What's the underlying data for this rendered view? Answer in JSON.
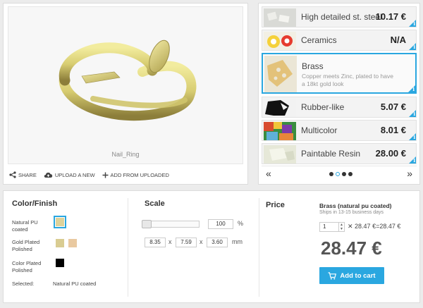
{
  "viewer": {
    "model_name": "Nail_Ring",
    "actions": [
      {
        "icon": "share-icon",
        "label": "SHARE"
      },
      {
        "icon": "cloud-upload-icon",
        "label": "UPLOAD A NEW"
      },
      {
        "icon": "plus-icon",
        "label": "ADD FROM UPLOADED"
      }
    ]
  },
  "materials": [
    {
      "name": "High detailed st. steel",
      "price": "10.17 €",
      "thumb": "steel-thumbnail"
    },
    {
      "name": "Ceramics",
      "price": "N/A",
      "thumb": "ceramics-thumbnail"
    },
    {
      "name": "Brass",
      "price": "",
      "description": "Copper meets Zinc, plated to have a 18kt gold look",
      "selected": true,
      "thumb": "brass-thumbnail"
    },
    {
      "name": "Rubber-like",
      "price": "5.07 €",
      "thumb": "rubber-thumbnail"
    },
    {
      "name": "Multicolor",
      "price": "8.01 €",
      "thumb": "multicolor-thumbnail"
    },
    {
      "name": "Paintable Resin",
      "price": "28.00 €",
      "thumb": "resin-thumbnail"
    }
  ],
  "carousel": {
    "prev": "«",
    "next": "»",
    "pages": 4,
    "active": 1
  },
  "color_finish": {
    "title": "Color/Finish",
    "options": [
      {
        "label": "Natural PU coated",
        "swatches": [
          "#ddd29a"
        ],
        "selected": true
      },
      {
        "label": "Gold Plated Polished",
        "swatches": [
          "#d9cc92",
          "#e9c9a0"
        ]
      },
      {
        "label": "Color Plated Polished",
        "swatches": [
          "#000000"
        ]
      }
    ],
    "selected_label": "Selected:",
    "selected_value": "Natural PU coated"
  },
  "scale": {
    "title": "Scale",
    "percent": "100",
    "percent_unit": "%",
    "dims": [
      "8.35",
      "7.59",
      "3.60"
    ],
    "x": "x",
    "unit": "mm"
  },
  "price": {
    "title": "Price",
    "material_title": "Brass (natural pu coated)",
    "shipping": "Ships in 13-15 business days",
    "quantity": "1",
    "calc": "✕ 28.47 €=28.47 €",
    "total": "28.47 €",
    "add_to_cart": "Add to cart"
  },
  "colors": {
    "accent": "#2aa7e0",
    "model": "#e3db8e"
  }
}
